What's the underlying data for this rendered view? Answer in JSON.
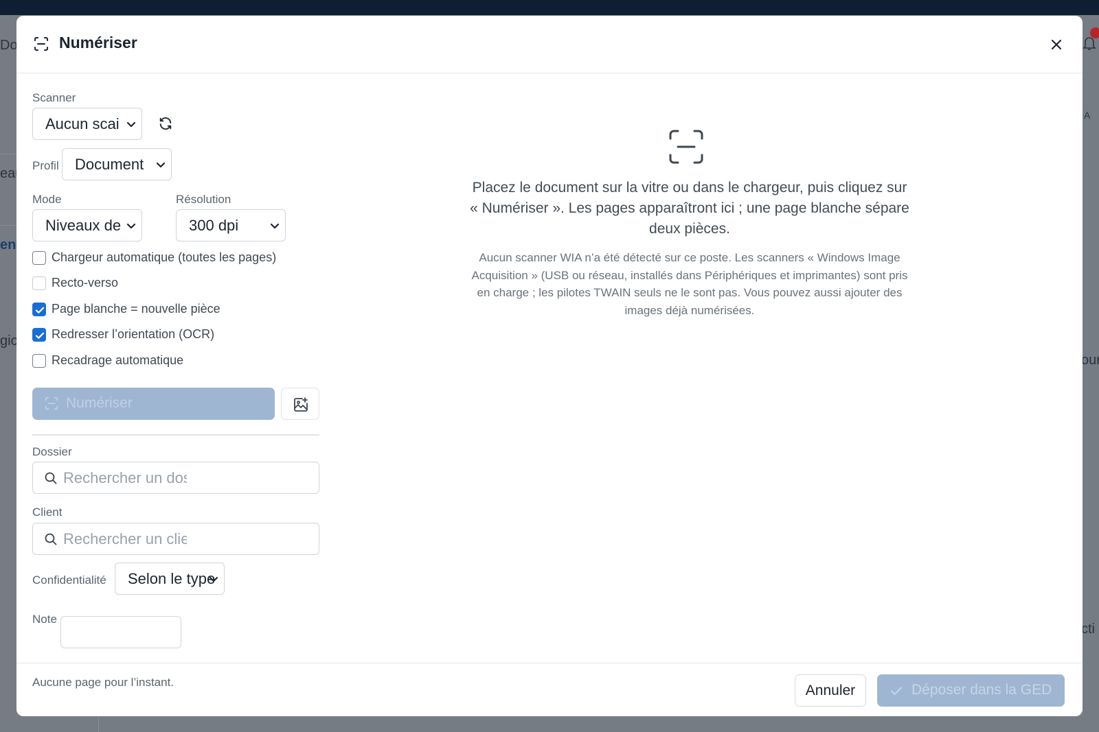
{
  "background": {
    "fragments": [
      "Do",
      "eau",
      "ent",
      "gic",
      "our",
      "cti",
      "A"
    ]
  },
  "dialog": {
    "title": "Numériser",
    "title_icon": "scan-icon",
    "close_icon": "close-icon"
  },
  "form": {
    "scanner": {
      "label": "Scanner",
      "value": "Aucun scai",
      "refresh_icon": "refresh-icon"
    },
    "profile": {
      "label": "Profil",
      "value": "Document"
    },
    "mode": {
      "label": "Mode",
      "value": "Niveaux de"
    },
    "resolution": {
      "label": "Résolution",
      "value": "300 dpi"
    },
    "options": [
      {
        "label": "Chargeur automatique (toutes les pages)",
        "checked": false,
        "disabled": false
      },
      {
        "label": "Recto-verso",
        "checked": false,
        "disabled": true
      },
      {
        "label": "Page blanche = nouvelle pièce",
        "checked": true,
        "disabled": false
      },
      {
        "label": "Redresser l’orientation (OCR)",
        "checked": true,
        "disabled": false
      },
      {
        "label": "Recadrage automatique",
        "checked": false,
        "disabled": false
      }
    ],
    "scan_button": "Numériser",
    "add_images_icon": "image-add-icon",
    "folder": {
      "label": "Dossier",
      "placeholder": "Rechercher un dossier"
    },
    "client": {
      "label": "Client",
      "placeholder": "Rechercher un client"
    },
    "confidentiality": {
      "label": "Confidentialité",
      "value": "Selon le type"
    },
    "note": {
      "label": "Note",
      "value": ""
    }
  },
  "empty_state": {
    "icon": "scan-icon",
    "message": "Placez le document sur la vitre ou dans le chargeur, puis cliquez sur « Numériser ». Les pages apparaîtront ici ; une page blanche sépare deux pièces.",
    "details": "Aucun scanner WIA n’a été détecté sur ce poste. Les scanners « Windows Image Acquisition » (USB ou réseau, installés dans Périphériques et imprimantes) sont pris en charge ; les pilotes TWAIN seuls ne le sont pas. Vous pouvez aussi ajouter des images déjà numérisées."
  },
  "footer": {
    "status": "Aucune page pour l’instant.",
    "cancel": "Annuler",
    "submit": "Déposer dans la GED"
  },
  "colors": {
    "accent": "#1a6dd7",
    "disabled_button": "#9fb6d2",
    "topbar": "#0f1e33"
  }
}
